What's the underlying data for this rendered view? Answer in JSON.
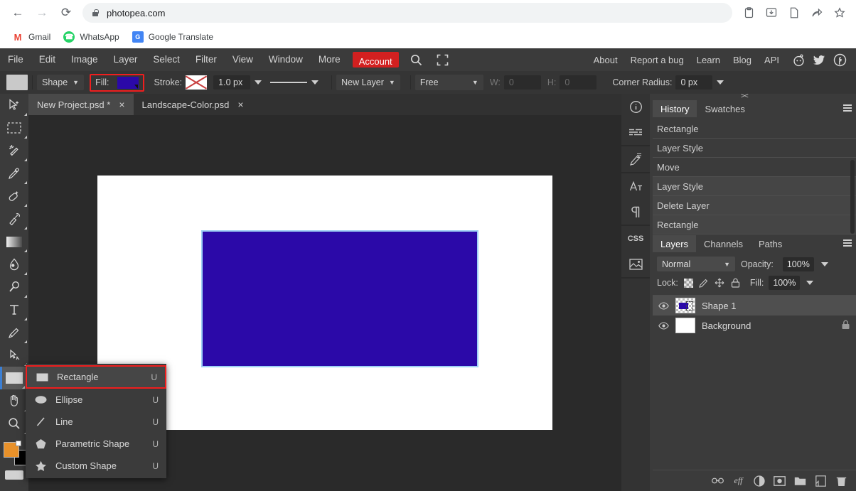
{
  "browser": {
    "url": "photopea.com",
    "nav": {
      "back": "back-arrow",
      "forward": "forward-arrow",
      "reload": "reload"
    },
    "toolbar_icons": [
      "clipboard-icon",
      "download-icon",
      "page-icon",
      "share-icon",
      "bookmark-star-icon"
    ],
    "bookmarks": [
      {
        "label": "Gmail",
        "icon": "gmail-icon",
        "glyph": "M"
      },
      {
        "label": "WhatsApp",
        "icon": "whatsapp-icon",
        "glyph": "✆"
      },
      {
        "label": "Google Translate",
        "icon": "google-translate-icon",
        "glyph": "G文"
      }
    ]
  },
  "menubar": {
    "items": [
      "File",
      "Edit",
      "Image",
      "Layer",
      "Select",
      "Filter",
      "View",
      "Window",
      "More"
    ],
    "account": "Account",
    "search_icon": "search-icon",
    "fullscreen_icon": "fullscreen-icon",
    "right_links": [
      "About",
      "Report a bug",
      "Learn",
      "Blog",
      "API"
    ],
    "social": [
      "reddit-icon",
      "twitter-icon",
      "facebook-icon"
    ]
  },
  "options": {
    "tool_preview": "rectangle-tool-preview",
    "mode": "Shape",
    "fill_label": "Fill:",
    "fill_color": "#2B09A8",
    "stroke_label": "Stroke:",
    "stroke_none": "none-stroke",
    "stroke_width": "1.0 px",
    "stroke_style": "solid-line",
    "path_op": "New Layer",
    "size_mode": "Free",
    "w_label": "W:",
    "w_value": "0",
    "h_label": "H:",
    "h_value": "0",
    "corner_label": "Corner Radius:",
    "corner_value": "0 px",
    "highlight_color": "#f01e1e"
  },
  "tabs": [
    {
      "title": "New Project.psd *",
      "active": true,
      "close": "×"
    },
    {
      "title": "Landscape-Color.psd",
      "active": false,
      "close": "×"
    }
  ],
  "toolbar": {
    "tools": [
      {
        "name": "move-tool"
      },
      {
        "name": "rectangle-select-tool"
      },
      {
        "name": "magic-wand-tool"
      },
      {
        "name": "eyedropper-tool"
      },
      {
        "name": "healing-brush-tool"
      },
      {
        "name": "clone-stamp-tool"
      },
      {
        "name": "gradient-tool"
      },
      {
        "name": "blur-tool"
      },
      {
        "name": "dodge-tool"
      },
      {
        "name": "type-tool"
      },
      {
        "name": "pen-tool"
      },
      {
        "name": "path-select-tool"
      },
      {
        "name": "shape-tool",
        "selected": true
      },
      {
        "name": "hand-tool"
      },
      {
        "name": "zoom-tool"
      }
    ],
    "foreground_color": "#E8912A",
    "background_color": "#000000",
    "keyboard_icon": "keyboard-icon"
  },
  "shape_menu": {
    "items": [
      {
        "label": "Rectangle",
        "shortcut": "U",
        "icon": "rectangle-icon",
        "selected": true
      },
      {
        "label": "Ellipse",
        "shortcut": "U",
        "icon": "ellipse-icon",
        "selected": false
      },
      {
        "label": "Line",
        "shortcut": "U",
        "icon": "line-icon",
        "selected": false
      },
      {
        "label": "Parametric Shape",
        "shortcut": "U",
        "icon": "pentagon-icon",
        "selected": false
      },
      {
        "label": "Custom Shape",
        "shortcut": "U",
        "icon": "star-icon",
        "selected": false
      }
    ]
  },
  "canvas": {
    "paper_color": "#ffffff",
    "shape_fill": "#2B09A8",
    "selection_outline": "#9ed0f5"
  },
  "right_rail": {
    "icons": [
      "info-icon",
      "histogram-icon",
      "brush-settings-icon",
      "character-icon",
      "paragraph-icon",
      "css-icon",
      "image-icon"
    ]
  },
  "history_panel": {
    "tabs": [
      {
        "label": "History",
        "active": true
      },
      {
        "label": "Swatches",
        "active": false
      }
    ],
    "menu_icon": "panel-menu-icon",
    "items": [
      "Rectangle",
      "Layer Style",
      "Move",
      "Layer Style",
      "Delete Layer",
      "Rectangle"
    ],
    "current_index": 5
  },
  "layers_panel": {
    "tabs": [
      {
        "label": "Layers",
        "active": true
      },
      {
        "label": "Channels",
        "active": false
      },
      {
        "label": "Paths",
        "active": false
      }
    ],
    "menu_icon": "panel-menu-icon",
    "blend_mode": "Normal",
    "opacity_label": "Opacity:",
    "opacity_value": "100%",
    "lock_label": "Lock:",
    "lock_icons": [
      "lock-transparency-icon",
      "lock-paint-icon",
      "lock-move-icon",
      "lock-all-icon"
    ],
    "fill_label": "Fill:",
    "fill_value": "100%",
    "layers": [
      {
        "name": "Shape 1",
        "visible": true,
        "selected": true,
        "locked": false,
        "thumb": "shape-thumbnail"
      },
      {
        "name": "Background",
        "visible": true,
        "selected": false,
        "locked": true,
        "thumb": "white-thumbnail"
      }
    ],
    "bottom_icons": [
      "link-layers-icon",
      "layer-effects-icon",
      "adjustment-layer-icon",
      "layer-mask-icon",
      "new-group-icon",
      "new-layer-icon",
      "delete-layer-icon"
    ]
  }
}
